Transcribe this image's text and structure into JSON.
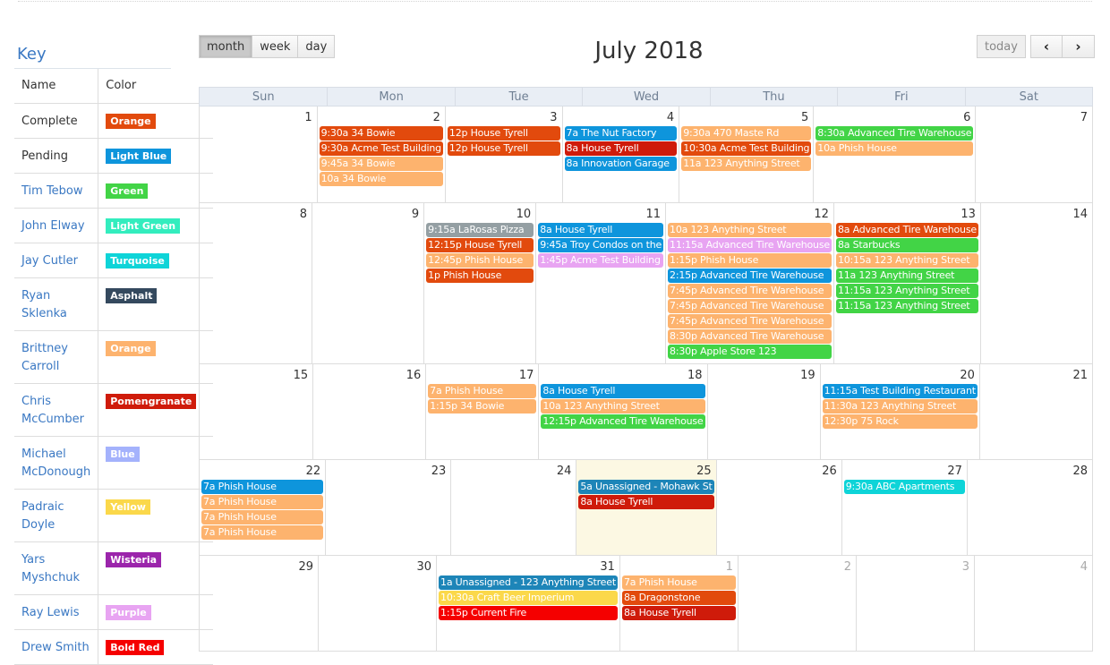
{
  "colors": {
    "orange_dark": "#e24a0d",
    "light_blue": "#0e95dc",
    "green": "#42d446",
    "light_green": "#33edbe",
    "turquoise": "#0ed4d8",
    "asphalt": "#34495e",
    "orange_light": "#fdb36e",
    "pomegranate": "#cf1b0a",
    "blue": "#a4b2fc",
    "yellow": "#fbd84a",
    "wisteria": "#9b25ab",
    "purple": "#e8a4f2",
    "bold_red": "#f50000",
    "gray": "#949fa3",
    "steel_blue": "#1d85b8"
  },
  "key": {
    "title": "Key",
    "headers": {
      "name": "Name",
      "color": "Color"
    },
    "rows": [
      {
        "name": "Complete",
        "color_label": "Orange",
        "color": "#e24a0d",
        "link": false
      },
      {
        "name": "Pending",
        "color_label": "Light Blue",
        "color": "#0e95dc",
        "link": false
      },
      {
        "name": "Tim Tebow",
        "color_label": "Green",
        "color": "#42d446",
        "link": true
      },
      {
        "name": "John Elway",
        "color_label": "Light Green",
        "color": "#33edbe",
        "link": true
      },
      {
        "name": "Jay Cutler",
        "color_label": "Turquoise",
        "color": "#0ed4d8",
        "link": true
      },
      {
        "name": "Ryan Sklenka",
        "color_label": "Asphalt",
        "color": "#34495e",
        "link": true
      },
      {
        "name": "Brittney Carroll",
        "color_label": "Orange",
        "color": "#fdb36e",
        "link": true
      },
      {
        "name": "Chris McCumber",
        "color_label": "Pomengranate",
        "color": "#cf1b0a",
        "link": true
      },
      {
        "name": "Michael McDonough",
        "color_label": "Blue",
        "color": "#a4b2fc",
        "link": true
      },
      {
        "name": "Padraic Doyle",
        "color_label": "Yellow",
        "color": "#fbd84a",
        "link": true
      },
      {
        "name": "Yars Myshchuk",
        "color_label": "Wisteria",
        "color": "#9b25ab",
        "link": true
      },
      {
        "name": "Ray Lewis",
        "color_label": "Purple",
        "color": "#e8a4f2",
        "link": true
      },
      {
        "name": "Drew Smith",
        "color_label": "Bold Red",
        "color": "#f50000",
        "link": true
      }
    ]
  },
  "toolbar": {
    "views": [
      {
        "label": "month",
        "active": true
      },
      {
        "label": "week",
        "active": false
      },
      {
        "label": "day",
        "active": false
      }
    ],
    "today_label": "today",
    "prev_icon": "‹",
    "next_icon": "›",
    "title": "July 2018"
  },
  "calendar": {
    "days_of_week": [
      "Sun",
      "Mon",
      "Tue",
      "Wed",
      "Thu",
      "Fri",
      "Sat"
    ],
    "weeks": [
      {
        "days": [
          {
            "num": "1",
            "events": []
          },
          {
            "num": "2",
            "events": [
              {
                "text": "9:30a 34 Bowie",
                "color": "#e24a0d"
              },
              {
                "text": "9:30a Acme Test Building",
                "color": "#e24a0d"
              },
              {
                "text": "9:45a 34 Bowie",
                "color": "#fdb36e"
              },
              {
                "text": "10a 34 Bowie",
                "color": "#fdb36e"
              }
            ]
          },
          {
            "num": "3",
            "events": [
              {
                "text": "12p House Tyrell",
                "color": "#e24a0d"
              },
              {
                "text": "12p House Tyrell",
                "color": "#e24a0d"
              }
            ]
          },
          {
            "num": "4",
            "events": [
              {
                "text": "7a The Nut Factory",
                "color": "#0e95dc"
              },
              {
                "text": "8a House Tyrell",
                "color": "#cf1b0a"
              },
              {
                "text": "8a Innovation Garage",
                "color": "#0e95dc"
              }
            ]
          },
          {
            "num": "5",
            "events": [
              {
                "text": "9:30a 470 Maste Rd",
                "color": "#fdb36e"
              },
              {
                "text": "10:30a Acme Test Building",
                "color": "#e24a0d"
              },
              {
                "text": "11a 123 Anything Street",
                "color": "#fdb36e"
              }
            ]
          },
          {
            "num": "6",
            "events": [
              {
                "text": "8:30a Advanced Tire Warehouse",
                "color": "#42d446"
              },
              {
                "text": "10a Phish House",
                "color": "#fdb36e"
              }
            ]
          },
          {
            "num": "7",
            "events": []
          }
        ]
      },
      {
        "days": [
          {
            "num": "8",
            "events": []
          },
          {
            "num": "9",
            "events": []
          },
          {
            "num": "10",
            "events": [
              {
                "text": "9:15a LaRosas Pizza",
                "color": "#949fa3"
              },
              {
                "text": "12:15p House Tyrell",
                "color": "#e24a0d"
              },
              {
                "text": "12:45p Phish House",
                "color": "#fdb36e"
              },
              {
                "text": "1p Phish House",
                "color": "#e24a0d"
              }
            ]
          },
          {
            "num": "11",
            "events": [
              {
                "text": "8a House Tyrell",
                "color": "#0e95dc"
              },
              {
                "text": "9:45a Troy Condos on the",
                "color": "#0e95dc"
              },
              {
                "text": "1:45p Acme Test Building",
                "color": "#e8a4f2"
              }
            ]
          },
          {
            "num": "12",
            "events": [
              {
                "text": "10a 123 Anything Street",
                "color": "#fdb36e"
              },
              {
                "text": "11:15a Advanced Tire Warehouse",
                "color": "#e8a4f2"
              },
              {
                "text": "1:15p Phish House",
                "color": "#fdb36e"
              },
              {
                "text": "2:15p Advanced Tire Warehouse",
                "color": "#0e95dc"
              },
              {
                "text": "7:45p Advanced Tire Warehouse",
                "color": "#fdb36e"
              },
              {
                "text": "7:45p Advanced Tire Warehouse",
                "color": "#fdb36e"
              },
              {
                "text": "7:45p Advanced Tire Warehouse",
                "color": "#fdb36e"
              },
              {
                "text": "8:30p Advanced Tire Warehouse",
                "color": "#fdb36e"
              },
              {
                "text": "8:30p Apple Store 123",
                "color": "#42d446"
              }
            ]
          },
          {
            "num": "13",
            "events": [
              {
                "text": "8a Advanced Tire Warehouse",
                "color": "#e24a0d"
              },
              {
                "text": "8a Starbucks",
                "color": "#42d446"
              },
              {
                "text": "10:15a 123 Anything Street",
                "color": "#fdb36e"
              },
              {
                "text": "11a 123 Anything Street",
                "color": "#42d446"
              },
              {
                "text": "11:15a 123 Anything Street",
                "color": "#42d446"
              },
              {
                "text": "11:15a 123 Anything Street",
                "color": "#42d446"
              }
            ]
          },
          {
            "num": "14",
            "events": []
          }
        ]
      },
      {
        "days": [
          {
            "num": "15",
            "events": []
          },
          {
            "num": "16",
            "events": []
          },
          {
            "num": "17",
            "events": [
              {
                "text": "7a Phish House",
                "color": "#fdb36e"
              },
              {
                "text": "1:15p 34 Bowie",
                "color": "#fdb36e"
              }
            ]
          },
          {
            "num": "18",
            "events": [
              {
                "text": "8a House Tyrell",
                "color": "#0e95dc"
              },
              {
                "text": "10a 123 Anything Street",
                "color": "#fdb36e"
              },
              {
                "text": "12:15p Advanced Tire Warehouse",
                "color": "#42d446"
              }
            ]
          },
          {
            "num": "19",
            "events": []
          },
          {
            "num": "20",
            "events": [
              {
                "text": "11:15a Test Building Restaurant",
                "color": "#0e95dc"
              },
              {
                "text": "11:30a 123 Anything Street",
                "color": "#fdb36e"
              },
              {
                "text": "12:30p 75 Rock",
                "color": "#fdb36e"
              }
            ]
          },
          {
            "num": "21",
            "events": []
          }
        ]
      },
      {
        "days": [
          {
            "num": "22",
            "events": [
              {
                "text": "7a Phish House",
                "color": "#0e95dc"
              },
              {
                "text": "7a Phish House",
                "color": "#fdb36e"
              },
              {
                "text": "7a Phish House",
                "color": "#fdb36e"
              },
              {
                "text": "7a Phish House",
                "color": "#fdb36e"
              }
            ]
          },
          {
            "num": "23",
            "events": []
          },
          {
            "num": "24",
            "events": []
          },
          {
            "num": "25",
            "today": true,
            "events": [
              {
                "text": "5a Unassigned - Mohawk St",
                "color": "#1d85b8"
              },
              {
                "text": "8a House Tyrell",
                "color": "#cf1b0a"
              }
            ]
          },
          {
            "num": "26",
            "events": []
          },
          {
            "num": "27",
            "events": [
              {
                "text": "9:30a ABC Apartments",
                "color": "#0ed4d8"
              }
            ]
          },
          {
            "num": "28",
            "events": []
          }
        ]
      },
      {
        "days": [
          {
            "num": "29",
            "events": []
          },
          {
            "num": "30",
            "events": []
          },
          {
            "num": "31",
            "events": [
              {
                "text": "1a Unassigned - 123 Anything Street",
                "color": "#1d85b8"
              },
              {
                "text": "10:30a Craft Beer Imperium",
                "color": "#fbd84a"
              },
              {
                "text": "1:15p Current Fire",
                "color": "#f50000"
              }
            ]
          },
          {
            "num": "1",
            "other": true,
            "events": [
              {
                "text": "7a Phish House",
                "color": "#fdb36e"
              },
              {
                "text": "8a Dragonstone",
                "color": "#e24a0d"
              },
              {
                "text": "8a House Tyrell",
                "color": "#cf1b0a"
              }
            ]
          },
          {
            "num": "2",
            "other": true,
            "events": []
          },
          {
            "num": "3",
            "other": true,
            "events": []
          },
          {
            "num": "4",
            "other": true,
            "events": []
          }
        ]
      }
    ]
  }
}
